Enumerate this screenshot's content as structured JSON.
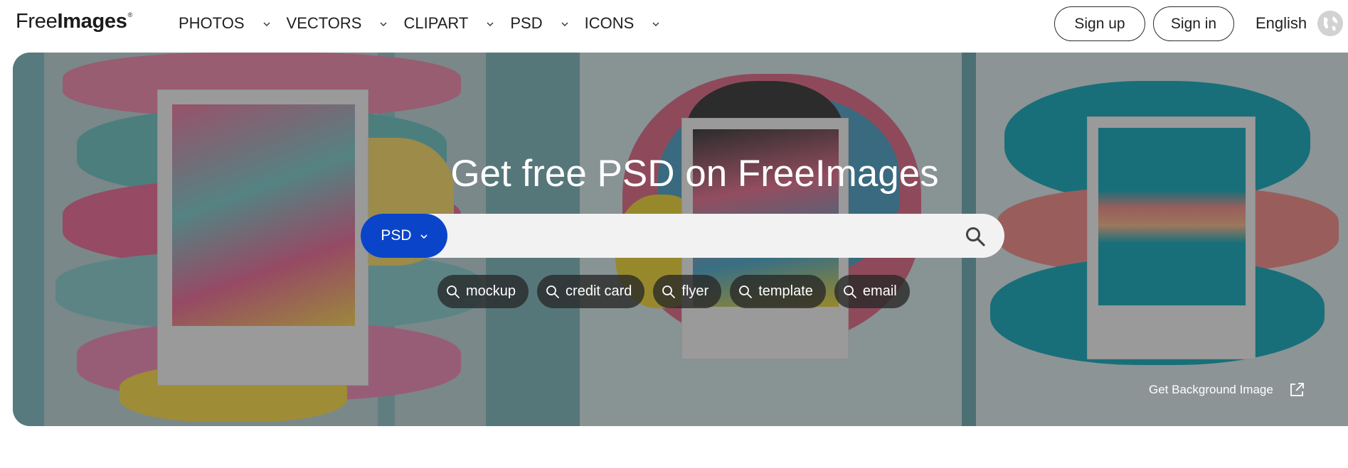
{
  "header": {
    "logo": {
      "part1": "Free",
      "part2": "Images",
      "mark": "®"
    },
    "nav": [
      {
        "label": "PHOTOS"
      },
      {
        "label": "VECTORS"
      },
      {
        "label": "CLIPART"
      },
      {
        "label": "PSD"
      },
      {
        "label": "ICONS"
      }
    ],
    "signup_label": "Sign up",
    "signin_label": "Sign in",
    "language": "English"
  },
  "hero": {
    "title": "Get free PSD on FreeImages",
    "search": {
      "type_label": "PSD",
      "placeholder": "",
      "value": ""
    },
    "tags": [
      {
        "label": "mockup"
      },
      {
        "label": "credit card"
      },
      {
        "label": "flyer"
      },
      {
        "label": "template"
      },
      {
        "label": "email"
      }
    ],
    "background_link": "Get Background Image"
  },
  "colors": {
    "accent": "#0a45c9",
    "text": "#1f1f1f",
    "tag_bg": "#282828",
    "search_bg": "#f2f2f2"
  },
  "icons": {
    "nav_chevron": "chevron-down-icon",
    "search": "search-icon",
    "tag": "search-icon",
    "external": "external-link-icon",
    "globe": "globe-icon"
  }
}
